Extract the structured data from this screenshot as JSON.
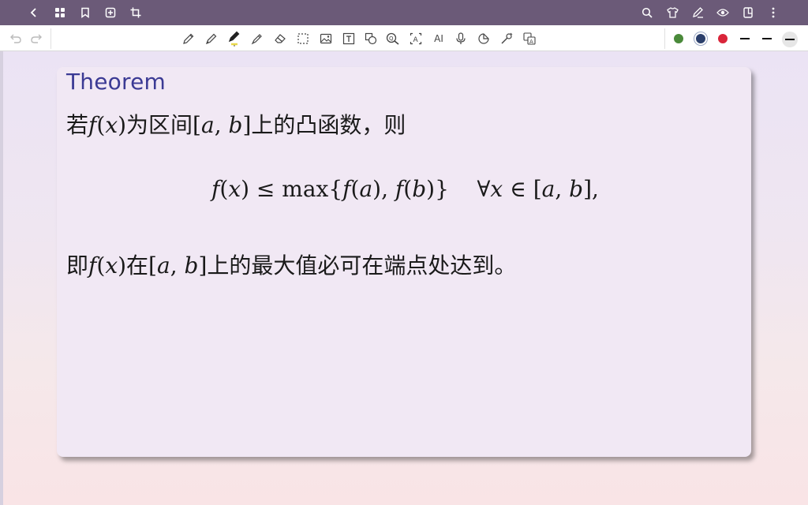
{
  "topbar": {
    "back_icon": "chevron-left-icon",
    "left_icons": [
      "grid-icon",
      "bookmark-icon",
      "add-page-icon",
      "crop-icon"
    ],
    "right_icons": [
      "search-icon",
      "shirt-icon",
      "pen-edit-icon",
      "eye-icon",
      "page-layout-icon",
      "more-vertical-icon"
    ]
  },
  "toolbar": {
    "undo_icon": "undo-icon",
    "redo_icon": "redo-icon",
    "tools": [
      "pencil-icon",
      "pen-icon",
      "highlighter-icon",
      "marker-icon",
      "eraser-icon",
      "lasso-select-icon",
      "image-icon",
      "text-box-icon",
      "shapes-icon",
      "ocr-icon",
      "text-recognize-icon",
      "ai-icon",
      "microphone-icon",
      "sticker-icon",
      "laser-pointer-icon",
      "translate-icon"
    ],
    "ai_label": "AI",
    "text_tool_label": "T",
    "colors": [
      "#4a8a3a",
      "#2b3f6b",
      "#d9253a"
    ],
    "active_highlight_color": "#e8d84a"
  },
  "card": {
    "title": "Theorem",
    "line1": {
      "p1": "若",
      "f": "f",
      "p2": "(",
      "x": "x",
      "p3": ")为区间[",
      "a": "a",
      "comma": ", ",
      "b": "b",
      "p4": "]上的凸函数，则"
    },
    "line2": {
      "f1": "f",
      "p1": "(",
      "x1": "x",
      "p2": ") ≤ max{",
      "f2": "f",
      "p3": "(",
      "a1": "a",
      "p4": "), ",
      "f3": "f",
      "p5": "(",
      "b1": "b",
      "p6": ")}",
      "space": "    ∀",
      "x2": "x",
      "p7": " ∈ [",
      "a2": "a",
      "comma": ", ",
      "b2": "b",
      "p8": "],"
    },
    "line3": {
      "p1": "即",
      "f": "f",
      "p2": "(",
      "x": "x",
      "p3": ")在[",
      "a": "a",
      "comma": ", ",
      "b": "b",
      "p4": "]上的最大值必可在端点处达到。"
    }
  },
  "colors": {
    "topbar": "#6b5a78",
    "title": "#3b3a94",
    "card": "#f1e8f4"
  }
}
